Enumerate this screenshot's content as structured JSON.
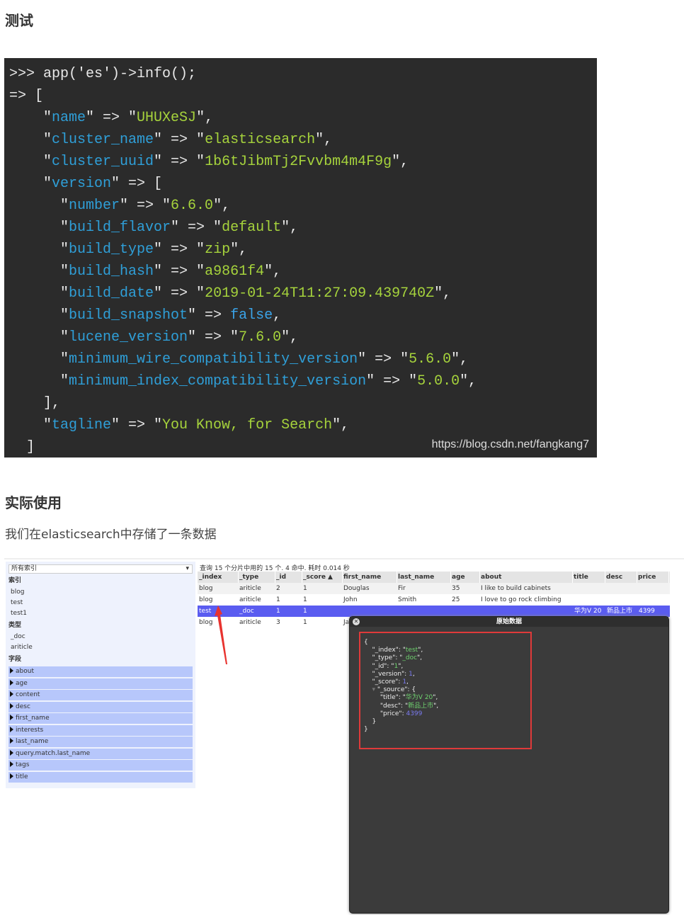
{
  "section1": {
    "title": "测试"
  },
  "code": {
    "lines": [
      [
        [
          ">>> app('es')->info();",
          ""
        ]
      ],
      [
        [
          "=> [",
          ""
        ]
      ],
      [
        [
          "    \"",
          ""
        ],
        [
          "name",
          "k"
        ],
        [
          "\" => \"",
          ""
        ],
        [
          "UHUXeSJ",
          "v"
        ],
        [
          "\",",
          ""
        ]
      ],
      [
        [
          "    \"",
          ""
        ],
        [
          "cluster_name",
          "k"
        ],
        [
          "\" => \"",
          ""
        ],
        [
          "elasticsearch",
          "v"
        ],
        [
          "\",",
          ""
        ]
      ],
      [
        [
          "    \"",
          ""
        ],
        [
          "cluster_uuid",
          "k"
        ],
        [
          "\" => \"",
          ""
        ],
        [
          "1b6tJibmTj2Fvvbm4m4F9g",
          "v"
        ],
        [
          "\",",
          ""
        ]
      ],
      [
        [
          "    \"",
          ""
        ],
        [
          "version",
          "k"
        ],
        [
          "\" => [",
          ""
        ]
      ],
      [
        [
          "      \"",
          ""
        ],
        [
          "number",
          "k"
        ],
        [
          "\" => \"",
          ""
        ],
        [
          "6.6.0",
          "v"
        ],
        [
          "\",",
          ""
        ]
      ],
      [
        [
          "      \"",
          ""
        ],
        [
          "build_flavor",
          "k"
        ],
        [
          "\" => \"",
          ""
        ],
        [
          "default",
          "v"
        ],
        [
          "\",",
          ""
        ]
      ],
      [
        [
          "      \"",
          ""
        ],
        [
          "build_type",
          "k"
        ],
        [
          "\" => \"",
          ""
        ],
        [
          "zip",
          "v"
        ],
        [
          "\",",
          ""
        ]
      ],
      [
        [
          "      \"",
          ""
        ],
        [
          "build_hash",
          "k"
        ],
        [
          "\" => \"",
          ""
        ],
        [
          "a9861f4",
          "v"
        ],
        [
          "\",",
          ""
        ]
      ],
      [
        [
          "      \"",
          ""
        ],
        [
          "build_date",
          "k"
        ],
        [
          "\" => \"",
          ""
        ],
        [
          "2019-01-24T11:27:09.439740Z",
          "v"
        ],
        [
          "\",",
          ""
        ]
      ],
      [
        [
          "      \"",
          ""
        ],
        [
          "build_snapshot",
          "k"
        ],
        [
          "\" => ",
          ""
        ],
        [
          "false",
          "b"
        ],
        [
          ",",
          ""
        ]
      ],
      [
        [
          "      \"",
          ""
        ],
        [
          "lucene_version",
          "k"
        ],
        [
          "\" => \"",
          ""
        ],
        [
          "7.6.0",
          "v"
        ],
        [
          "\",",
          ""
        ]
      ],
      [
        [
          "      \"",
          ""
        ],
        [
          "minimum_wire_compatibility_version",
          "k"
        ],
        [
          "\" => \"",
          ""
        ],
        [
          "5.6.0",
          "v"
        ],
        [
          "\",",
          ""
        ]
      ],
      [
        [
          "      \"",
          ""
        ],
        [
          "minimum_index_compatibility_version",
          "k"
        ],
        [
          "\" => \"",
          ""
        ],
        [
          "5.0.0",
          "v"
        ],
        [
          "\",",
          ""
        ]
      ],
      [
        [
          "    ],",
          ""
        ]
      ],
      [
        [
          "    \"",
          ""
        ],
        [
          "tagline",
          "k"
        ],
        [
          "\" => \"",
          ""
        ],
        [
          "You Know, for Search",
          "v"
        ],
        [
          "\",",
          ""
        ]
      ],
      [
        [
          "  ]",
          ""
        ]
      ]
    ],
    "watermark": "https://blog.csdn.net/fangkang7"
  },
  "section2": {
    "title": "实际使用",
    "paragraph": "我们在elasticsearch中存储了一条数据"
  },
  "app": {
    "index_select": "所有索引",
    "indices_label": "索引",
    "indices": [
      "blog",
      "test",
      "test1"
    ],
    "types_label": "类型",
    "types": [
      "_doc",
      "ariticle"
    ],
    "fields_label": "字段",
    "fields": [
      "about",
      "age",
      "content",
      "desc",
      "first_name",
      "interests",
      "last_name",
      "query.match.last_name",
      "tags",
      "title"
    ],
    "status": "查询 15 个分片中用的 15 个. 4 命中. 耗时 0.014 秒",
    "columns": [
      "_index",
      "_type",
      "_id",
      "_score ▲",
      "first_name",
      "last_name",
      "age",
      "about",
      "title",
      "desc",
      "price"
    ],
    "rows": [
      [
        "blog",
        "ariticle",
        "2",
        "1",
        "Douglas",
        "Fir",
        "35",
        "I like to build cabinets",
        "",
        "",
        ""
      ],
      [
        "blog",
        "ariticle",
        "1",
        "1",
        "John",
        "Smith",
        "25",
        "I love to go rock climbing",
        "",
        "",
        ""
      ],
      [
        "test",
        "_doc",
        "1",
        "1",
        "",
        "",
        "",
        "",
        "华为V 20",
        "新品上市",
        "4399"
      ],
      [
        "blog",
        "ariticle",
        "3",
        "1",
        "Ja",
        "",
        "",
        "",
        "",
        "",
        ""
      ]
    ],
    "selected_row": 2,
    "modal": {
      "title": "原始数据",
      "json": {
        "_index": "test",
        "_type": "_doc",
        "_id": "1",
        "_version": "1",
        "_score": "1",
        "title": "华为V 20",
        "desc": "新品上市",
        "price": "4399"
      }
    }
  }
}
